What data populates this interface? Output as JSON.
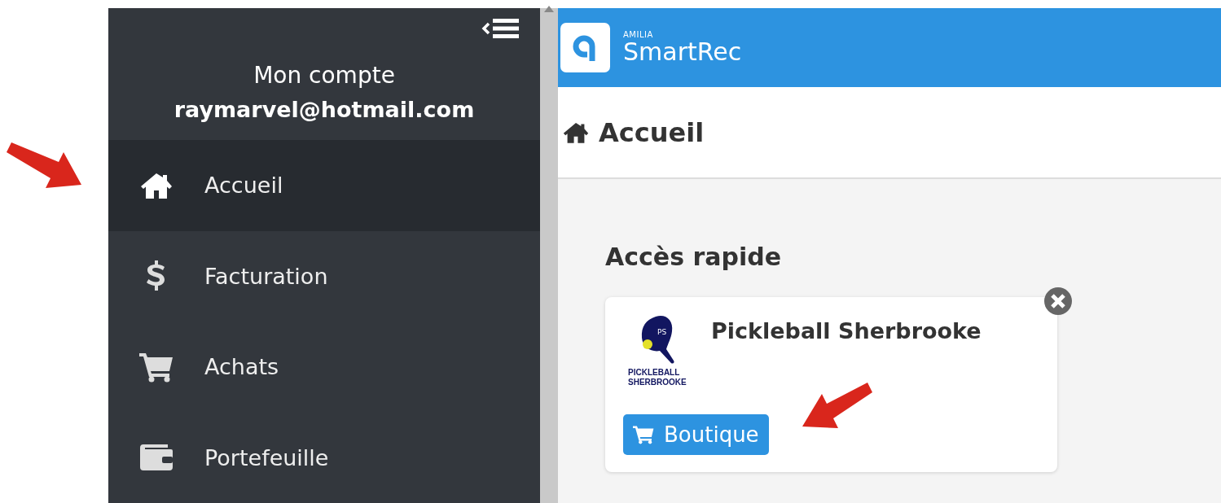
{
  "sidebar": {
    "account_label": "Mon compte",
    "email": "raymarvel@hotmail.com",
    "items": [
      {
        "label": "Accueil",
        "kind": "home",
        "selected": true
      },
      {
        "label": "Facturation",
        "kind": "billing",
        "selected": false
      },
      {
        "label": "Achats",
        "kind": "purchases",
        "selected": false
      },
      {
        "label": "Portefeuille",
        "kind": "wallet",
        "selected": false
      }
    ]
  },
  "header": {
    "brand_small": "AMILIA",
    "brand": "SmartRec"
  },
  "page": {
    "title": "Accueil"
  },
  "quick_access": {
    "heading": "Accès rapide",
    "cards": [
      {
        "title": "Pickleball Sherbrooke",
        "logo_initials": "PS",
        "logo_lines": [
          "PICKLEBALL",
          "SHERBROOKE"
        ],
        "button": "Boutique"
      }
    ]
  }
}
